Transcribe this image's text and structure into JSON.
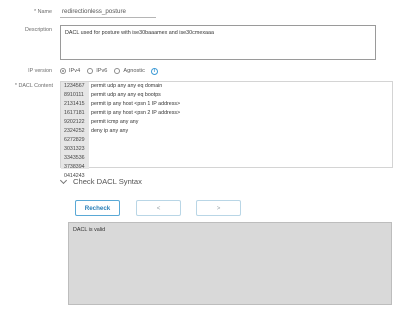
{
  "form": {
    "name_label": "* Name",
    "name_value": "redirectionless_posture",
    "description_label": "Description",
    "description_value": "DACL used for posture with ise30baaamex and ise30cmexaaa",
    "ip_version_label": "IP version",
    "ip_options": [
      {
        "label": "IPv4",
        "selected": true
      },
      {
        "label": "IPv6",
        "selected": false
      },
      {
        "label": "Agnostic",
        "selected": false
      }
    ],
    "info_icon": "info-icon",
    "dacl_label": "* DACL Content"
  },
  "dacl": {
    "line_numbers": [
      "1234567",
      "8910111",
      "2131415",
      "1617181",
      "9202122",
      "2324252",
      "6272829",
      "3031323",
      "3343536",
      "3738394",
      "0414243"
    ],
    "lines": [
      "permit udp any any eq domain",
      "permit udp any any eq bootps",
      "permit ip any host <psn 1 IP address>",
      "permit ip any host <psn 2 IP address>",
      "permit icmp any any",
      "deny ip any any"
    ]
  },
  "syntax": {
    "section_title": "Check DACL Syntax",
    "recheck_label": "Recheck",
    "prev_label": "<",
    "next_label": ">",
    "result_text": "DACL is valid"
  }
}
